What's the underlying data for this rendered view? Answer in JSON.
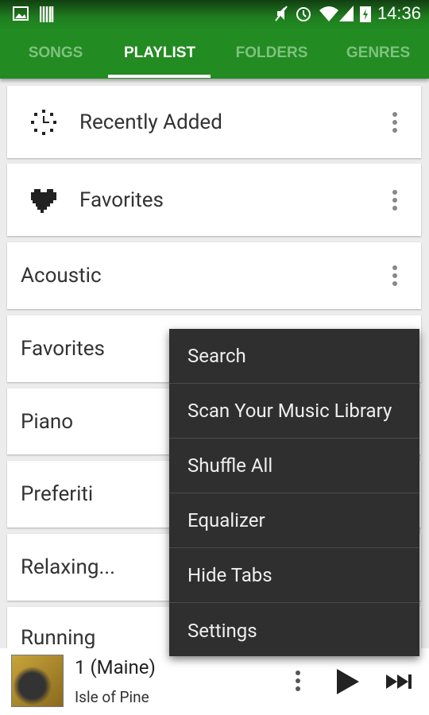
{
  "status_bar": {
    "time": "14:36",
    "icons": [
      "image-icon",
      "barcode-icon",
      "mute-icon",
      "alarm-icon",
      "wifi-icon",
      "signal-icon",
      "battery-charging-icon"
    ]
  },
  "tabs": [
    {
      "label": "SONGS"
    },
    {
      "label": "PLAYLIST",
      "active": true
    },
    {
      "label": "FOLDERS"
    },
    {
      "label": "GENRES"
    }
  ],
  "playlists": [
    {
      "label": "Recently Added",
      "icon": "clock-icon"
    },
    {
      "label": "Favorites",
      "icon": "heart-icon"
    },
    {
      "label": "Acoustic"
    },
    {
      "label": "Favorites"
    },
    {
      "label": "Piano"
    },
    {
      "label": "Preferiti"
    },
    {
      "label": "Relaxing..."
    },
    {
      "label": "Running"
    }
  ],
  "menu": [
    "Search",
    "Scan Your Music Library",
    "Shuffle All",
    "Equalizer",
    "Hide Tabs",
    "Settings"
  ],
  "player": {
    "title": "1 (Maine)",
    "artist": "Isle of Pine"
  },
  "colors": {
    "accent": "#228b22",
    "menu_bg": "#2f2f2f"
  }
}
